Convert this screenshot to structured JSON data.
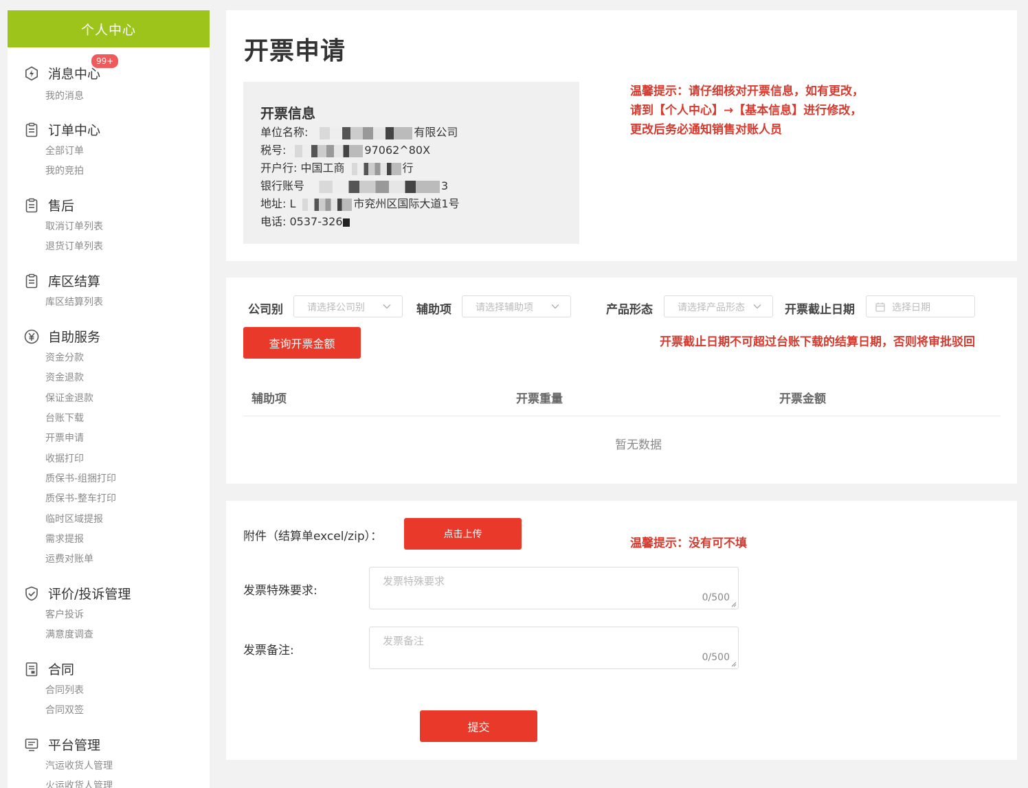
{
  "sidebar": {
    "header": "个人中心",
    "groups": [
      {
        "label": "消息中心",
        "icon": "bolt-circle-icon",
        "badge": "99+",
        "items": [
          "我的消息"
        ]
      },
      {
        "label": "订单中心",
        "icon": "clipboard-icon",
        "items": [
          "全部订单",
          "我的竞拍"
        ]
      },
      {
        "label": "售后",
        "icon": "clipboard-icon",
        "items": [
          "取消订单列表",
          "退货订单列表"
        ]
      },
      {
        "label": "库区结算",
        "icon": "clipboard-icon",
        "items": [
          "库区结算列表"
        ]
      },
      {
        "label": "自助服务",
        "icon": "yen-circle-icon",
        "items": [
          "资金分款",
          "资金退款",
          "保证金退款",
          "台账下载",
          "开票申请",
          "收据打印",
          "质保书-组捆打印",
          "质保书-整车打印",
          "临时区域提报",
          "需求提报",
          "运费对账单"
        ]
      },
      {
        "label": "评价/投诉管理",
        "icon": "shield-check-icon",
        "items": [
          "客户投诉",
          "满意度调查"
        ]
      },
      {
        "label": "合同",
        "icon": "document-icon",
        "items": [
          "合同列表",
          "合同双签"
        ]
      },
      {
        "label": "平台管理",
        "icon": "monitor-icon",
        "items": [
          "汽运收货人管理",
          "火运收货人管理"
        ]
      }
    ]
  },
  "invoice": {
    "title": "开票申请",
    "info_title": "开票信息",
    "company_label": "单位名称:",
    "company_suffix": "有限公司",
    "tax_label": "税号:",
    "tax_suffix": "97062^80X",
    "bank_label": "开户行:",
    "bank_value": "中国工商",
    "bank_suffix": "行",
    "account_label": "银行账号",
    "account_suffix": "3",
    "address_label": "地址:",
    "address_prefix": "L",
    "address_suffix": "市兖州区国际大道1号",
    "phone_label": "电话:",
    "phone_value": "0537-326",
    "tip_lines": [
      "温馨提示：请仔细核对开票信息，如有更改，",
      "请到【个人中心】→【基本信息】进行修改，",
      "更改后务必通知销售对账人员"
    ]
  },
  "query": {
    "filters": [
      {
        "label": "公司别",
        "placeholder": "请选择公司别"
      },
      {
        "label": "辅助项",
        "placeholder": "请选择辅助项"
      },
      {
        "label": "产品形态",
        "placeholder": "请选择产品形态"
      },
      {
        "label": "开票截止日期",
        "placeholder": "选择日期"
      }
    ],
    "button": "查询开票金额",
    "warning": "开票截止日期不可超过台账下载的结算日期，否则将审批驳回",
    "columns": [
      "辅助项",
      "开票重量",
      "开票金额"
    ],
    "empty": "暂无数据"
  },
  "upload": {
    "attachment_label": "附件（结算单excel/zip）：",
    "upload_button": "点击上传",
    "tip": "温馨提示：没有可不填",
    "special_label": "发票特殊要求:",
    "special_placeholder": "发票特殊要求",
    "special_count": "0/500",
    "remark_label": "发票备注:",
    "remark_placeholder": "发票备注",
    "remark_count": "0/500",
    "submit": "提交"
  },
  "colors": {
    "accent_green": "#9cc41a",
    "primary_red": "#e8392b",
    "tip_red": "#d63a2e",
    "badge": "#f15a5a"
  }
}
